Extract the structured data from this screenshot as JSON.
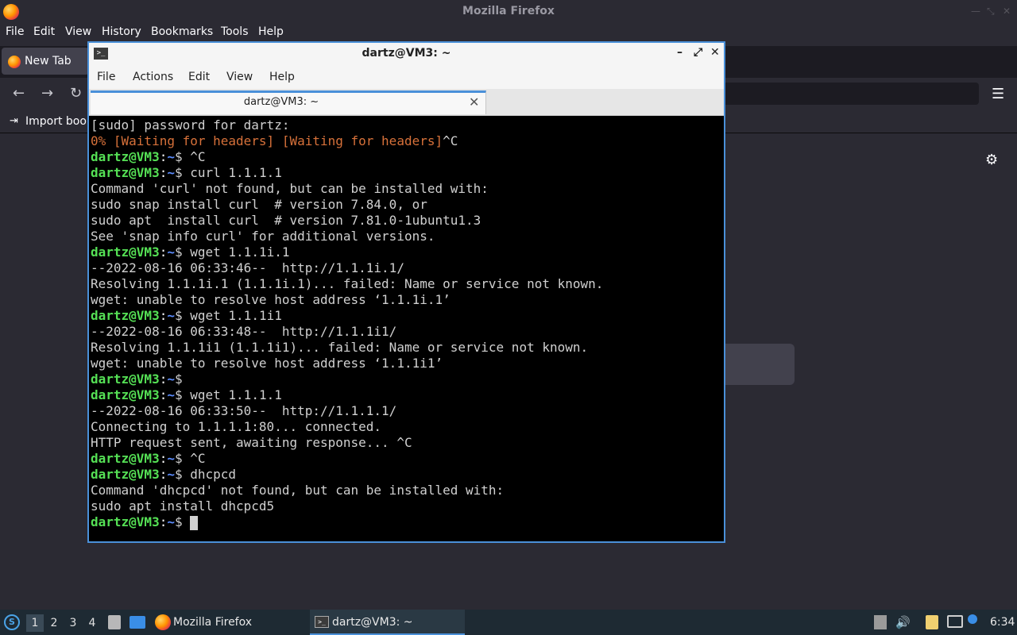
{
  "firefox": {
    "window_title": "Mozilla Firefox",
    "menus": [
      "File",
      "Edit",
      "View",
      "History",
      "Bookmarks",
      "Tools",
      "Help"
    ],
    "tab_label": "New Tab",
    "bookmarks_import_label": "Import book"
  },
  "terminal": {
    "window_title": "dartz@VM3: ~",
    "menus": [
      "File",
      "Actions",
      "Edit",
      "View",
      "Help"
    ],
    "tab_label": "dartz@VM3: ~",
    "prompt": {
      "user": "dartz@VM3",
      "sep": ":",
      "path": "~",
      "sym": "$ "
    },
    "lines": [
      {
        "type": "out",
        "text": "[sudo] password for dartz:"
      },
      {
        "type": "warn",
        "text": "0% [Waiting for headers] [Waiting for headers]",
        "suffix": "^C"
      },
      {
        "type": "cmd",
        "text": "^C"
      },
      {
        "type": "cmd",
        "text": "curl 1.1.1.1"
      },
      {
        "type": "out",
        "text": "Command 'curl' not found, but can be installed with:"
      },
      {
        "type": "out",
        "text": "sudo snap install curl  # version 7.84.0, or"
      },
      {
        "type": "out",
        "text": "sudo apt  install curl  # version 7.81.0-1ubuntu1.3"
      },
      {
        "type": "out",
        "text": "See 'snap info curl' for additional versions."
      },
      {
        "type": "cmd",
        "text": "wget 1.1.1i.1"
      },
      {
        "type": "out",
        "text": "--2022-08-16 06:33:46--  http://1.1.1i.1/"
      },
      {
        "type": "out",
        "text": "Resolving 1.1.1i.1 (1.1.1i.1)... failed: Name or service not known."
      },
      {
        "type": "out",
        "text": "wget: unable to resolve host address ‘1.1.1i.1’"
      },
      {
        "type": "cmd",
        "text": "wget 1.1.1i1"
      },
      {
        "type": "out",
        "text": "--2022-08-16 06:33:48--  http://1.1.1i1/"
      },
      {
        "type": "out",
        "text": "Resolving 1.1.1i1 (1.1.1i1)... failed: Name or service not known."
      },
      {
        "type": "out",
        "text": "wget: unable to resolve host address ‘1.1.1i1’"
      },
      {
        "type": "cmd",
        "text": ""
      },
      {
        "type": "cmd",
        "text": "wget 1.1.1.1"
      },
      {
        "type": "out",
        "text": "--2022-08-16 06:33:50--  http://1.1.1.1/"
      },
      {
        "type": "out",
        "text": "Connecting to 1.1.1.1:80... connected."
      },
      {
        "type": "out",
        "text": "HTTP request sent, awaiting response... ^C"
      },
      {
        "type": "cmd",
        "text": "^C"
      },
      {
        "type": "cmd",
        "text": "dhcpcd"
      },
      {
        "type": "out",
        "text": "Command 'dhcpcd' not found, but can be installed with:"
      },
      {
        "type": "out",
        "text": "sudo apt install dhcpcd5"
      },
      {
        "type": "cursor",
        "text": ""
      }
    ]
  },
  "taskbar": {
    "workspaces": [
      "1",
      "2",
      "3",
      "4"
    ],
    "active_workspace": "1",
    "tasks": [
      "Mozilla Firefox",
      "dartz@VM3: ~"
    ],
    "clock": "6:34"
  },
  "colors": {
    "accent": "#4a90d9",
    "prompt_user": "#55e055",
    "prompt_path": "#5c8dff",
    "warn_text": "#d7713a"
  }
}
